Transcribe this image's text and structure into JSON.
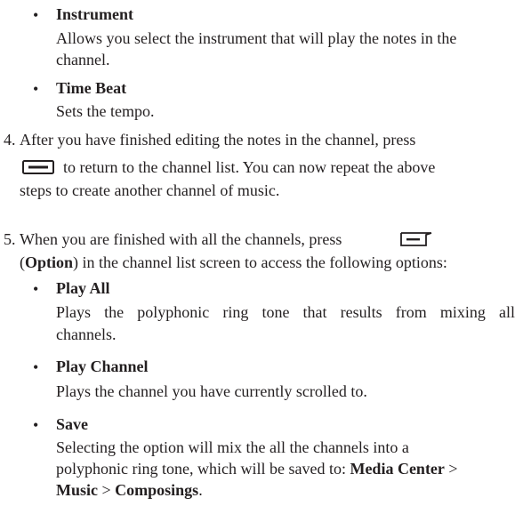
{
  "opts_top": [
    {
      "title": "Instrument",
      "desc": [
        "Allows you select the instrument that will play the notes in the",
        "channel."
      ]
    },
    {
      "title": "Time Beat",
      "desc": [
        "Sets the tempo."
      ]
    }
  ],
  "step4": {
    "number": "4.",
    "line1": "After you have finished editing the notes in the channel, press",
    "line2_after_key": "to return to the channel list. You can now repeat the above",
    "line3": "steps to create another channel of music."
  },
  "step5": {
    "number": "5.",
    "line1": "When you are finished with all the channels, press",
    "line2_paren_open": "(",
    "line2_option": "Option",
    "line2_rest": ") in the channel list screen to access the following options:"
  },
  "opts_bottom": [
    {
      "title": "Play All",
      "desc": [
        "Plays the polyphonic ring tone that results from mixing all",
        "channels."
      ]
    },
    {
      "title": "Play Channel",
      "desc": [
        "Plays the channel you have currently scrolled to."
      ]
    },
    {
      "title": "Save",
      "desc": [
        "Selecting the option will mix the all the channels into a",
        "polyphonic ring tone, which will be saved to: "
      ],
      "path": [
        "Media Center",
        " > ",
        "Music",
        " > ",
        "Composings",
        "."
      ]
    }
  ],
  "bullet_char": "•",
  "icons": [
    "left-softkey-icon",
    "option-softkey-icon"
  ]
}
